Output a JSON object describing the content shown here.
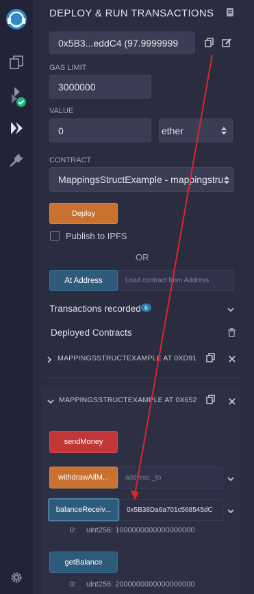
{
  "app": {
    "panel_title": "DEPLOY & RUN TRANSACTIONS"
  },
  "sidebar": {
    "icons": [
      "remix-logo-icon",
      "file-explorer-icon",
      "compiler-icon",
      "deploy-run-icon",
      "plugin-manager-icon",
      "settings-icon"
    ],
    "compiler_badge_color": "#1cb581"
  },
  "account": {
    "value": "0x5B3...eddC4 (97.9999999"
  },
  "gas_limit": {
    "label": "GAS LIMIT",
    "value": "3000000"
  },
  "value_field": {
    "label": "VALUE",
    "amount": "0",
    "unit": "ether"
  },
  "contract": {
    "label": "CONTRACT",
    "selected": "MappingsStructExample - mappingstru"
  },
  "deploy": {
    "label": "Deploy",
    "publish_label": "Publish to IPFS",
    "or_label": "OR",
    "at_address_label": "At Address",
    "at_address_placeholder": "Load contract from Address"
  },
  "transactions": {
    "label": "Transactions recorded",
    "count": "6"
  },
  "deployed": {
    "label": "Deployed Contracts",
    "instances": [
      {
        "name": "MAPPINGSSTRUCTEXAMPLE AT 0XD91"
      },
      {
        "name": "MAPPINGSSTRUCTEXAMPLE AT 0X652",
        "functions": {
          "send_money": "sendMoney",
          "withdraw_all": "withdrawAllM...",
          "withdraw_placeholder": "address _to",
          "balance_received": "balanceReceiv...",
          "balance_input": "0x5B38Da6a701c568545dC",
          "balance_output_index": "0:",
          "balance_output": "uint256: 1000000000000000000",
          "get_balance": "getBalance",
          "get_balance_output_index": "0:",
          "get_balance_output": "uint256: 2000000000000000000"
        }
      }
    ]
  },
  "colors": {
    "orange": "#c9722f",
    "red": "#c13637",
    "blue": "#2e5a7c",
    "badge": "#2a7aa6",
    "arrow": "#e0252a"
  }
}
